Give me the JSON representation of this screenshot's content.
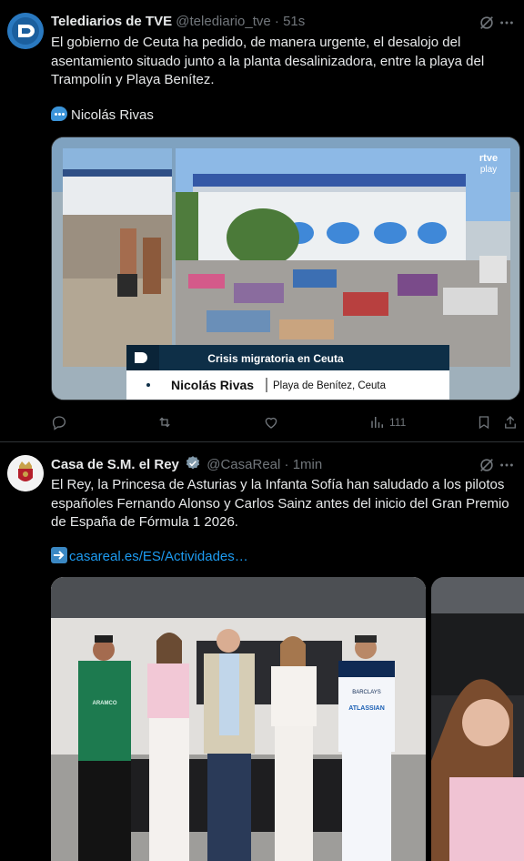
{
  "tweets": [
    {
      "author_name": "Telediarios de TVE",
      "handle": "@telediario_tve",
      "separator": "·",
      "time": "51s",
      "text": "El gobierno de Ceuta ha pedido, de manera urgente, el desalojo del asentamiento situado junto a la planta desalinizadora, entre la playa del Trampolín y Playa Benítez.",
      "credit": "Nicolás Rivas",
      "media": {
        "watermark_line1": "rtve",
        "watermark_line2": "play",
        "lower_third_title": "Crisis migratoria en Ceuta",
        "lower_third_name": "Nicolás Rivas",
        "lower_third_location": "Playa de Benítez, Ceuta"
      },
      "actions": {
        "reply": "",
        "repost": "",
        "like": "",
        "views": "111"
      }
    },
    {
      "author_name": "Casa de S.M. el Rey",
      "handle": "@CasaReal",
      "separator": "·",
      "time": "1min",
      "text": "El Rey, la Princesa de Asturias y la Infanta Sofía han saludado a los pilotos españoles Fernando Alonso y Carlos Sainz antes del inicio del Gran Premio de España de Fórmula 1 2026.",
      "link": "casareal.es/ES/Actividades…",
      "media": {
        "sponsor_1": "ATLASSIAN",
        "sponsor_2": "BARCLAYS",
        "sponsor_3": "ARAMCO"
      }
    }
  ],
  "colors": {
    "background": "#000000",
    "text": "#e7e9ea",
    "muted": "#71767b",
    "link": "#1d9bf0",
    "divider": "#2f3336",
    "verified": "#829aab"
  }
}
